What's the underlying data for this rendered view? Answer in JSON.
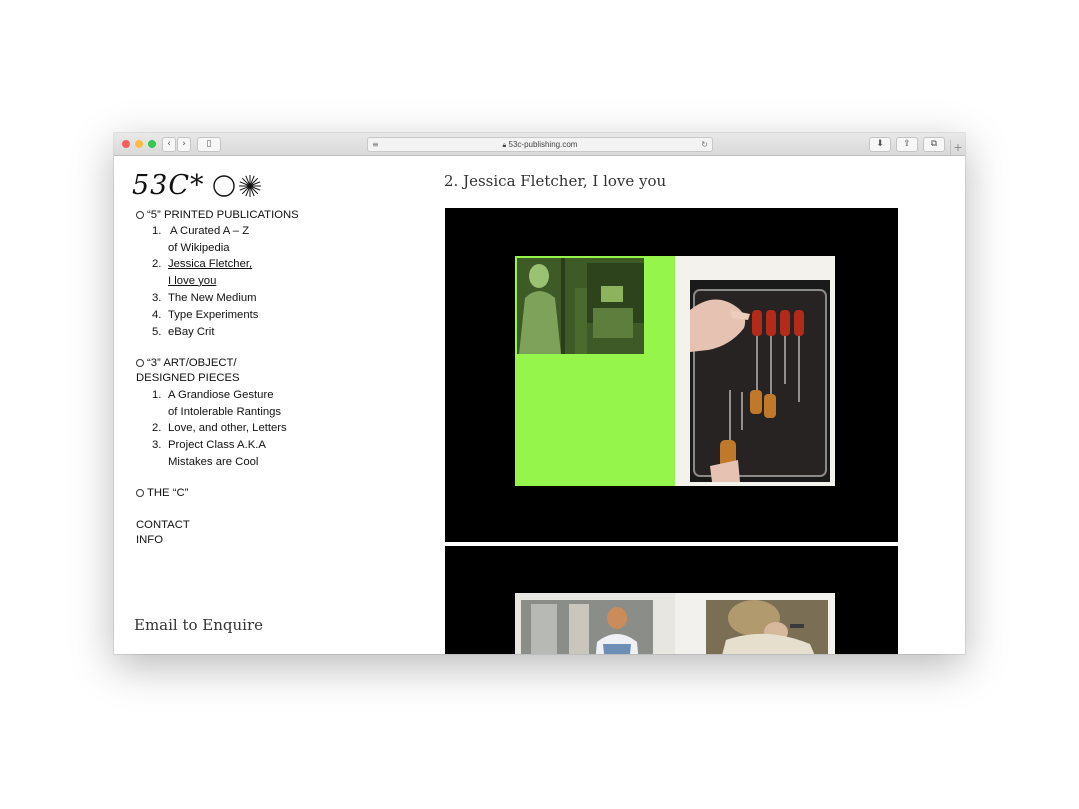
{
  "browser": {
    "url": "53c-publishing.com",
    "new_tab_label": "+"
  },
  "site": {
    "logo_text": "53C*"
  },
  "nav": {
    "printed": {
      "title": "“5” PRINTED PUBLICATIONS",
      "items": [
        {
          "num": "1.",
          "line1": "A Curated A – Z",
          "line2": "of Wikipedia"
        },
        {
          "num": "2.",
          "line1": "Jessica Fletcher,",
          "line2": "I love you"
        },
        {
          "num": "3.",
          "line1": "The New Medium"
        },
        {
          "num": "4.",
          "line1": "Type Experiments"
        },
        {
          "num": "5.",
          "line1": "eBay Crit"
        }
      ]
    },
    "art": {
      "title_line1": "“3” ART/OBJECT/",
      "title_line2": "DESIGNED PIECES",
      "items": [
        {
          "num": "1.",
          "line1": "A Grandiose Gesture",
          "line2": "of Intolerable Rantings"
        },
        {
          "num": "2.",
          "line1": "Love, and other, Letters"
        },
        {
          "num": "3.",
          "line1": "Project Class A.K.A",
          "line2": "Mistakes are Cool"
        }
      ]
    },
    "the_c": "THE “C”",
    "contact": "CONTACT",
    "info": "INFO"
  },
  "footer": {
    "enquire": "Email to Enquire"
  },
  "project": {
    "title": "2. Jessica Fletcher, I love you"
  },
  "colors": {
    "accent_green": "#96f54b",
    "panel_black": "#000000"
  }
}
